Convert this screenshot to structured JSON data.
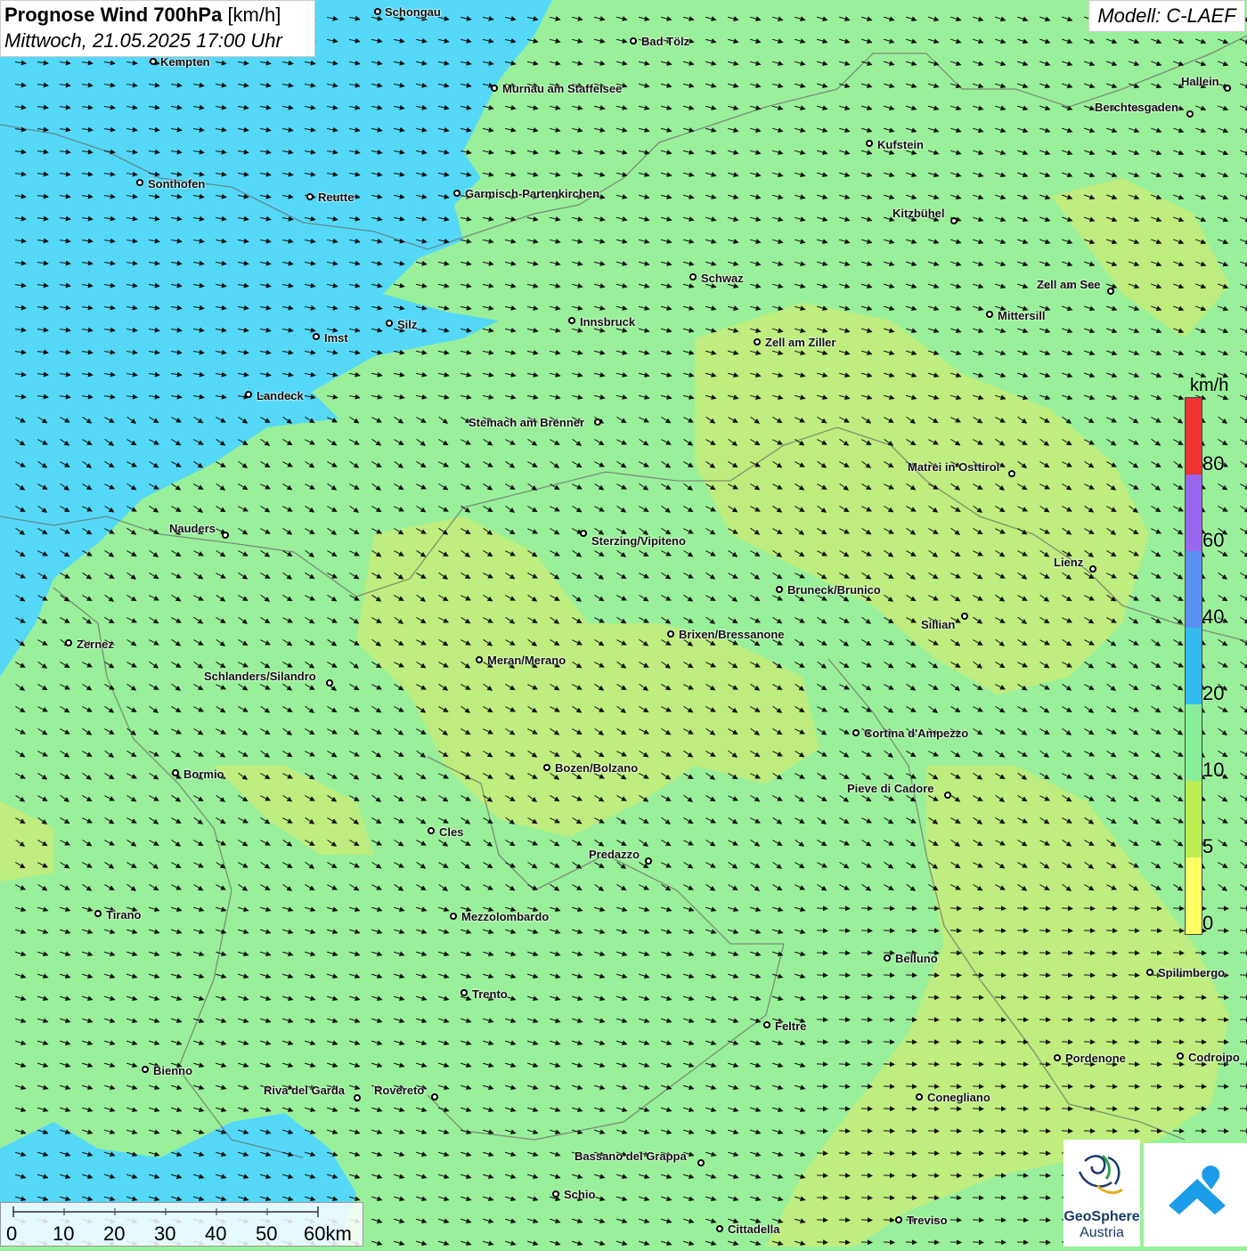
{
  "title": {
    "main": "Prognose Wind 700hPa",
    "unit": "[km/h]",
    "datetime": "Mittwoch, 21.05.2025 17:00 Uhr"
  },
  "model": "Modell: C-LAEF",
  "legend": {
    "unit": "km/h",
    "labels": [
      "80",
      "60",
      "40",
      "20",
      "10",
      "5",
      "0"
    ],
    "colors": [
      "#ee3333",
      "#9966ee",
      "#5b8ff0",
      "#33bbee",
      "#88ee99",
      "#bbee55",
      "#ffff66"
    ]
  },
  "scale": {
    "labels": [
      "0",
      "10",
      "20",
      "30",
      "40",
      "50",
      "60km"
    ]
  },
  "logo": {
    "name": "GeoSphere",
    "sub": "Austria"
  },
  "cities": [
    "Schongau",
    "Bad Tölz",
    "Kempten",
    "Murnau am Staffelsee",
    "Hallein",
    "Berchtesgaden",
    "Kufstein",
    "Sonthofen",
    "Reutte",
    "Garmisch-Partenkirchen",
    "Kitzbühel",
    "Schwaz",
    "Zell am See",
    "Innsbruck",
    "Mittersill",
    "Silz",
    "Imst",
    "Zell am Ziller",
    "Landeck",
    "Steinach am Brenner",
    "Matrei in Osttirol",
    "Nauders",
    "Sterzing/Vipiteno",
    "Lienz",
    "Bruneck/Brunico",
    "Sillian",
    "Brixen/Bressanone",
    "Zernez",
    "Meran/Merano",
    "Schlanders/Silandro",
    "Cortina d'Ampezzo",
    "Bormio",
    "Bozen/Bolzano",
    "Pieve di Cadore",
    "Cles",
    "Predazzo",
    "Tirano",
    "Mezzolombardo",
    "Belluno",
    "Spilimbergo",
    "Trento",
    "Feltre",
    "Bienno",
    "Pordenone",
    "Codroipo",
    "Riva del Garda",
    "Rovereto",
    "Conegliano",
    "Bassano del Grappa",
    "Schio",
    "Treviso",
    "Cittadella"
  ]
}
